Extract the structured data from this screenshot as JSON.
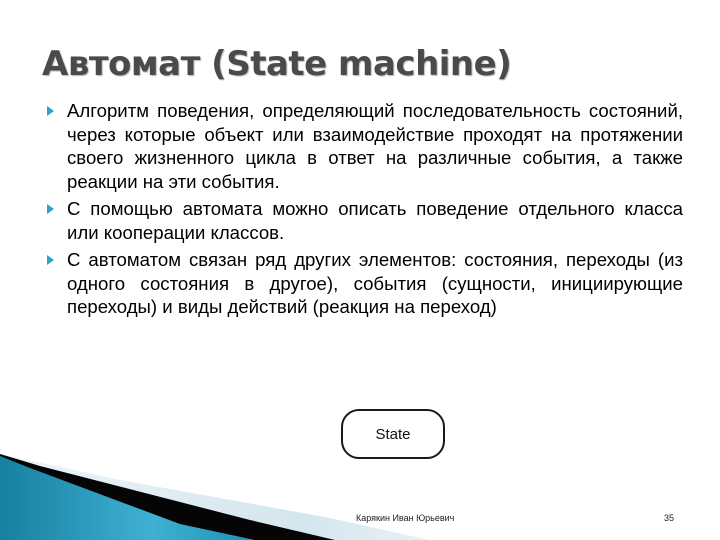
{
  "slide": {
    "title": "Автомат (State machine)",
    "bullets": [
      {
        "text": "Алгоритм поведения, определяющий последовательность состояний, через которые объект или взаимодействие проходят на протяжении своего жизненного цикла в ответ на различные события, а также реакции на эти события."
      },
      {
        "text": "С помощью автомата можно описать поведение отдельного класса или кооперации классов."
      },
      {
        "text": "С автоматом связан ряд других элементов: состояния, переходы (из одного состояния в другое), события (сущности, инициирующие переходы) и виды действий (реакция на переход)"
      }
    ],
    "diagram": {
      "state_label": "State"
    },
    "footer": {
      "author": "Карякин Иван Юрьевич",
      "page_number": "35"
    },
    "colors": {
      "title": "#4a4a4a",
      "bullet_marker": "#31a3c6",
      "wave_teal": "#1f8fb3",
      "wave_light": "#d6e7ef"
    }
  }
}
